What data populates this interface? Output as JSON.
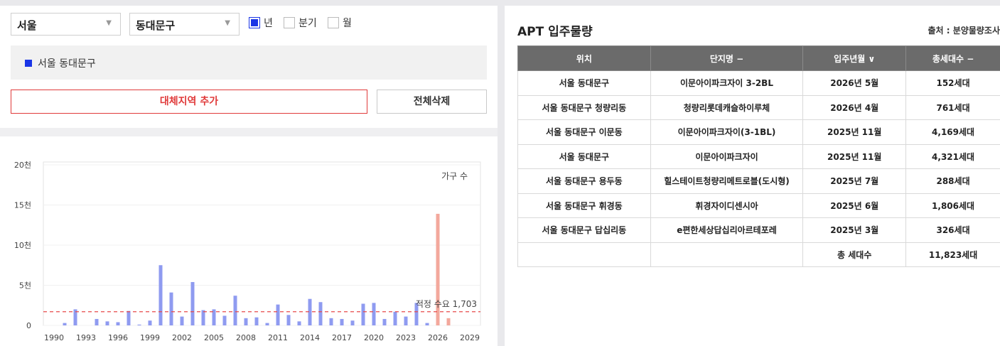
{
  "filters": {
    "city": "서울",
    "district": "동대문구",
    "period_options": [
      {
        "label": "년",
        "checked": true
      },
      {
        "label": "분기",
        "checked": false
      },
      {
        "label": "월",
        "checked": false
      }
    ]
  },
  "region_tag": "서울 동대문구",
  "buttons": {
    "add_region": "대체지역 추가",
    "delete_all": "전체삭제"
  },
  "chart_data": {
    "type": "bar",
    "legend": "가구 수",
    "ylim": [
      0,
      20000
    ],
    "yticks": [
      "0",
      "5천",
      "10천",
      "15천",
      "20천"
    ],
    "ytick_values": [
      0,
      5000,
      10000,
      15000,
      20000
    ],
    "xticks": [
      "1990",
      "1993",
      "1996",
      "1999",
      "2002",
      "2005",
      "2008",
      "2011",
      "2014",
      "2017",
      "2020",
      "2023",
      "2026",
      "2029"
    ],
    "xlim": [
      1989,
      2030
    ],
    "reference_line": {
      "label": "적정 수요 1,703",
      "value": 1703
    },
    "colors": {
      "past": "#8f9bf0",
      "future": "#f3a89c",
      "reference": "#e84a4a"
    },
    "series": [
      {
        "x": 1991,
        "value": 300
      },
      {
        "x": 1992,
        "value": 2000
      },
      {
        "x": 1994,
        "value": 800
      },
      {
        "x": 1995,
        "value": 500
      },
      {
        "x": 1996,
        "value": 400
      },
      {
        "x": 1997,
        "value": 1800
      },
      {
        "x": 1998,
        "value": 100
      },
      {
        "x": 1999,
        "value": 600
      },
      {
        "x": 2000,
        "value": 7500
      },
      {
        "x": 2001,
        "value": 4100
      },
      {
        "x": 2002,
        "value": 1100
      },
      {
        "x": 2003,
        "value": 5400
      },
      {
        "x": 2004,
        "value": 1900
      },
      {
        "x": 2005,
        "value": 2000
      },
      {
        "x": 2006,
        "value": 1200
      },
      {
        "x": 2007,
        "value": 3700
      },
      {
        "x": 2008,
        "value": 900
      },
      {
        "x": 2009,
        "value": 1000
      },
      {
        "x": 2010,
        "value": 300
      },
      {
        "x": 2011,
        "value": 2600
      },
      {
        "x": 2012,
        "value": 1300
      },
      {
        "x": 2013,
        "value": 500
      },
      {
        "x": 2014,
        "value": 3300
      },
      {
        "x": 2015,
        "value": 2900
      },
      {
        "x": 2016,
        "value": 900
      },
      {
        "x": 2017,
        "value": 800
      },
      {
        "x": 2018,
        "value": 600
      },
      {
        "x": 2019,
        "value": 2700
      },
      {
        "x": 2020,
        "value": 2800
      },
      {
        "x": 2021,
        "value": 800
      },
      {
        "x": 2022,
        "value": 1700
      },
      {
        "x": 2023,
        "value": 1100
      },
      {
        "x": 2024,
        "value": 2800
      },
      {
        "x": 2025,
        "value": 300
      },
      {
        "x": 2026,
        "value": 13900
      },
      {
        "x": 2027,
        "value": 900
      }
    ],
    "projection_start": 2026
  },
  "supply_panel": {
    "title": "APT 입주물량",
    "source": "출처 : 분양물량조사",
    "columns": [
      "위치",
      "단지명 −",
      "입주년월 ∨",
      "총세대수 −"
    ],
    "rows": [
      [
        "서울 동대문구",
        "이문아이파크자이 3-2BL",
        "2026년 5월",
        "152세대"
      ],
      [
        "서울 동대문구 청량리동",
        "청량리롯데캐슬하이루체",
        "2026년 4월",
        "761세대"
      ],
      [
        "서울 동대문구 이문동",
        "이문아이파크자이(3-1BL)",
        "2025년 11월",
        "4,169세대"
      ],
      [
        "서울 동대문구",
        "이문아이파크자이",
        "2025년 11월",
        "4,321세대"
      ],
      [
        "서울 동대문구 용두동",
        "힐스테이트청량리메트로블(도시형)",
        "2025년 7월",
        "288세대"
      ],
      [
        "서울 동대문구 휘경동",
        "휘경자이디센시아",
        "2025년 6월",
        "1,806세대"
      ],
      [
        "서울 동대문구 답십리동",
        "e편한세상답십리아르테포레",
        "2025년 3월",
        "326세대"
      ]
    ],
    "total_label": "총 세대수",
    "total_value": "11,823세대"
  }
}
